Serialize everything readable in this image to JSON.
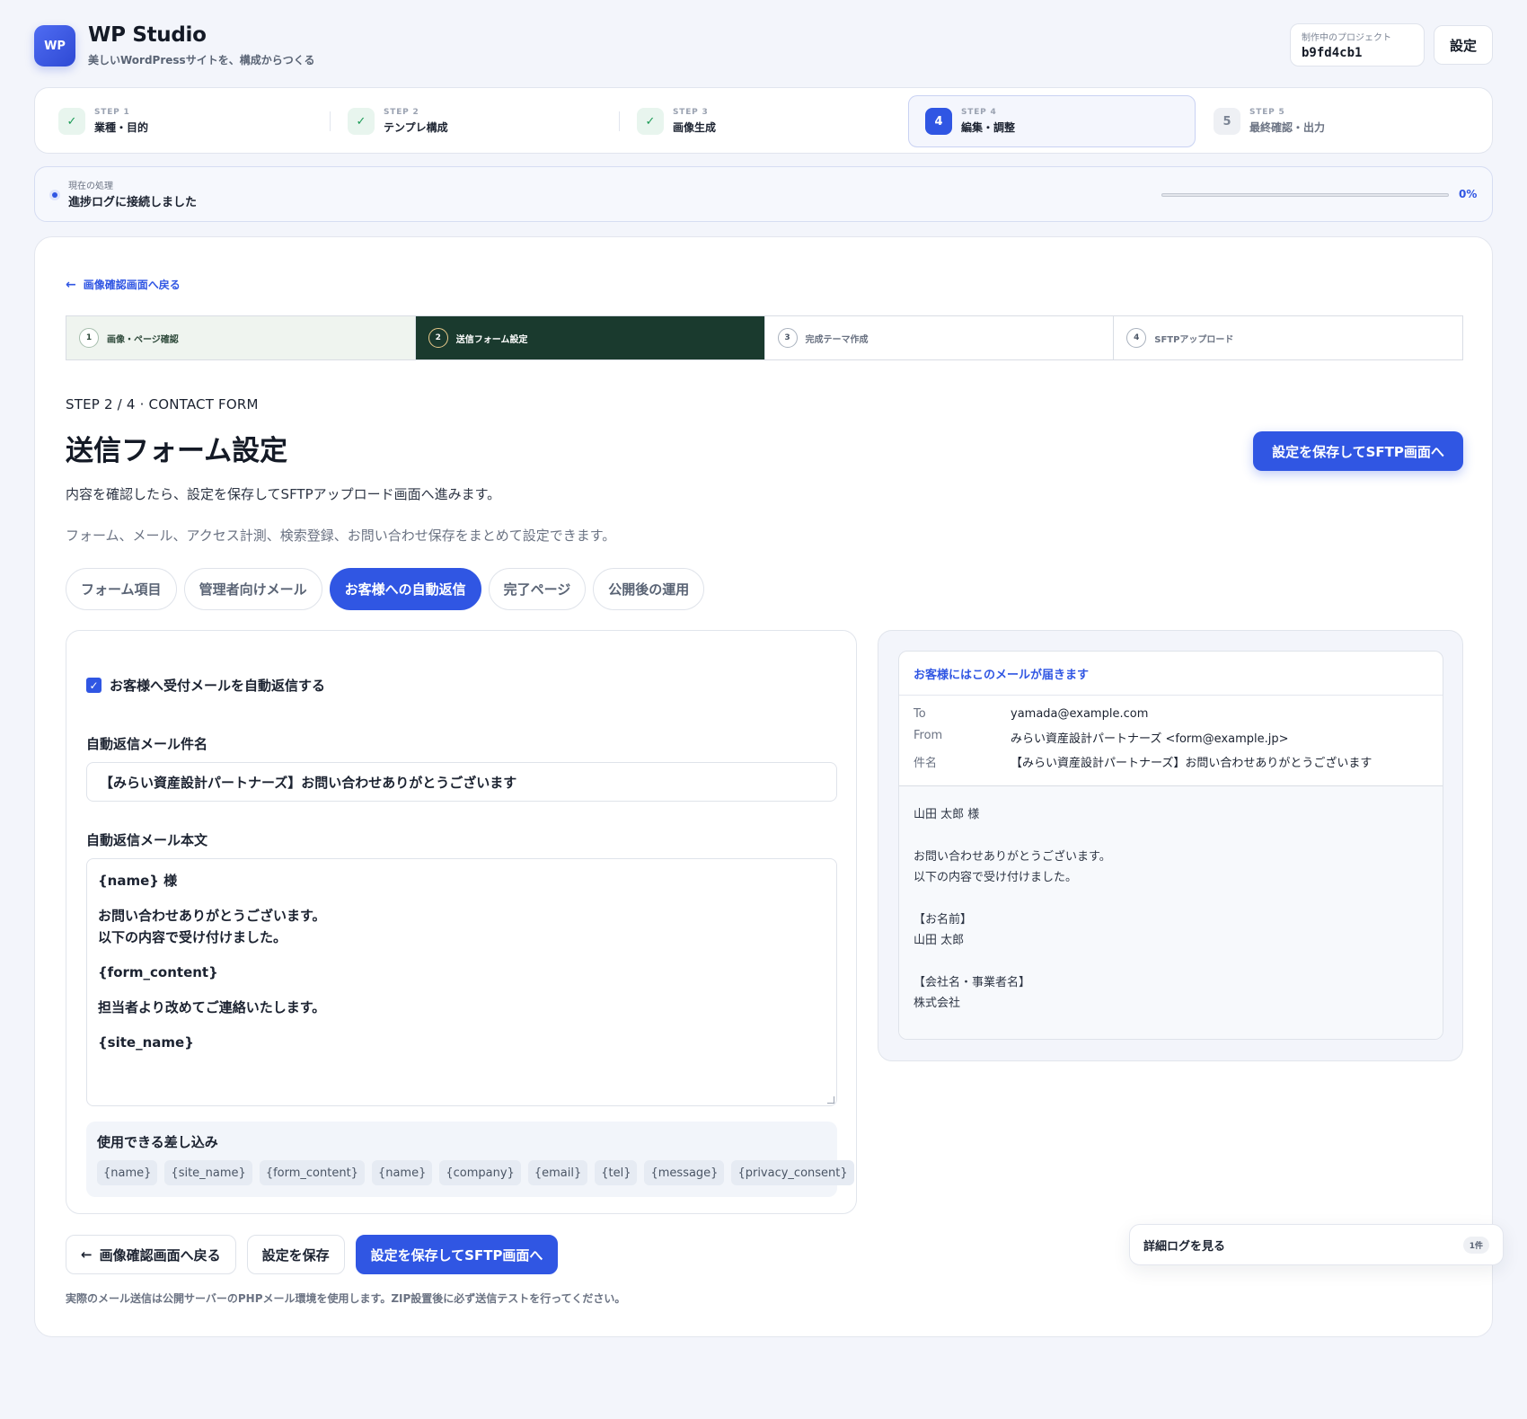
{
  "app": {
    "logo": "WP",
    "title": "WP Studio",
    "subtitle": "美しいWordPressサイトを、構成からつくる",
    "project_label": "制作中のプロジェクト",
    "project_id": "b9fd4cb1",
    "settings_label": "設定"
  },
  "steps": [
    {
      "num": "STEP 1",
      "label": "業種・目的",
      "state": "done",
      "icon": "✓"
    },
    {
      "num": "STEP 2",
      "label": "テンプレ構成",
      "state": "done",
      "icon": "✓"
    },
    {
      "num": "STEP 3",
      "label": "画像生成",
      "state": "done",
      "icon": "✓"
    },
    {
      "num": "STEP 4",
      "label": "編集・調整",
      "state": "active",
      "icon": "4"
    },
    {
      "num": "STEP 5",
      "label": "最終確認・出力",
      "state": "pending",
      "icon": "5"
    }
  ],
  "progress": {
    "label": "現在の処理",
    "status": "進捗ログに接続しました",
    "percent_label": "0%",
    "percent": 0
  },
  "main": {
    "back_link": "画像確認画面へ戻る",
    "substeps": [
      {
        "num": "1",
        "label": "画像・ページ確認",
        "state": "done"
      },
      {
        "num": "2",
        "label": "送信フォーム設定",
        "state": "active"
      },
      {
        "num": "3",
        "label": "完成テーマ作成",
        "state": "pending"
      },
      {
        "num": "4",
        "label": "SFTPアップロード",
        "state": "pending"
      }
    ],
    "eyebrow": "STEP 2 / 4 · CONTACT FORM",
    "title": "送信フォーム設定",
    "primary_cta": "設定を保存してSFTP画面へ",
    "desc1": "内容を確認したら、設定を保存してSFTPアップロード画面へ進みます。",
    "desc2": "フォーム、メール、アクセス計測、検索登録、お問い合わせ保存をまとめて設定できます。",
    "tabs": [
      {
        "label": "フォーム項目",
        "active": false
      },
      {
        "label": "管理者向けメール",
        "active": false
      },
      {
        "label": "お客様への自動返信",
        "active": true
      },
      {
        "label": "完了ページ",
        "active": false
      },
      {
        "label": "公開後の運用",
        "active": false
      }
    ]
  },
  "form": {
    "autoreply_checkbox_label": "お客様へ受付メールを自動返信する",
    "autoreply_checked": true,
    "subject_label": "自動返信メール件名",
    "subject_value": "【みらい資産設計パートナーズ】お問い合わせありがとうございます",
    "body_label": "自動返信メール本文",
    "body_lines": {
      "l1": "{name} 様",
      "l2": "お問い合わせありがとうございます。",
      "l3": "以下の内容で受け付けました。",
      "l4": "{form_content}",
      "l5": "担当者より改めてご連絡いたします。",
      "l6": "{site_name}"
    },
    "vars_title": "使用できる差し込み",
    "vars": [
      "{name}",
      "{site_name}",
      "{form_content}",
      "{name}",
      "{company}",
      "{email}",
      "{tel}",
      "{message}",
      "{privacy_consent}"
    ]
  },
  "preview": {
    "heading": "お客様にはこのメールが届きます",
    "to_key": "To",
    "to_value": "yamada@example.com",
    "from_key": "From",
    "from_value": "みらい資産設計パートナーズ <form@example.jp>",
    "subject_key": "件名",
    "subject_value": "【みらい資産設計パートナーズ】お問い合わせありがとうございます",
    "body": {
      "b1": "山田  太郎  様",
      "b2": "お問い合わせありがとうございます。",
      "b3": "以下の内容で受け付けました。",
      "b4": "【お名前】",
      "b5": "山田  太郎",
      "b6": "【会社名・事業者名】",
      "b7": "株式会社"
    }
  },
  "actions": {
    "back": "画像確認画面へ戻る",
    "save": "設定を保存",
    "save_next": "設定を保存してSFTP画面へ",
    "footnote": "実際のメール送信は公開サーバーのPHPメール環境を使用します。ZIP設置後に必ず送信テストを行ってください。"
  },
  "log": {
    "label": "詳細ログを見る",
    "count": "1件"
  },
  "colors": {
    "accent": "#3056e3",
    "active_substep": "#1a3a2e",
    "done_check": "#1a9a55"
  }
}
